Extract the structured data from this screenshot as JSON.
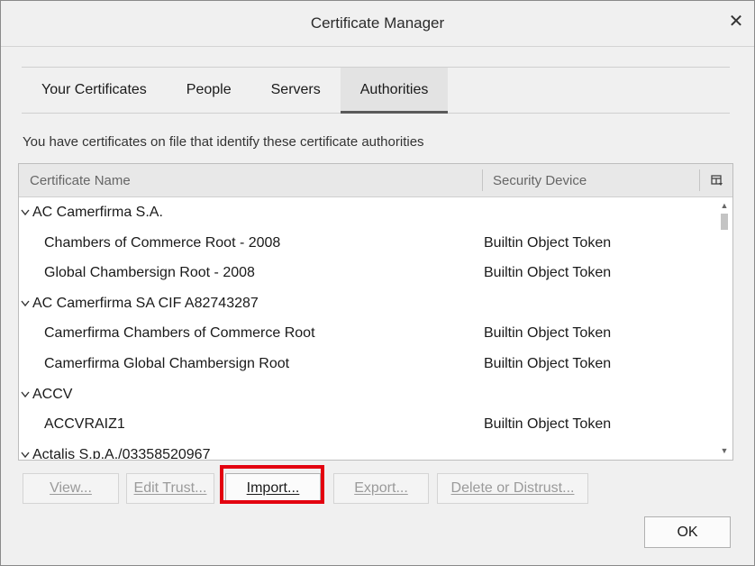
{
  "window": {
    "title": "Certificate Manager"
  },
  "tabs": [
    {
      "label": "Your Certificates",
      "active": false
    },
    {
      "label": "People",
      "active": false
    },
    {
      "label": "Servers",
      "active": false
    },
    {
      "label": "Authorities",
      "active": true
    }
  ],
  "description": "You have certificates on file that identify these certificate authorities",
  "tree": {
    "columns": {
      "name": "Certificate Name",
      "device": "Security Device"
    },
    "rows": [
      {
        "type": "group",
        "name": "AC Camerfirma S.A.",
        "device": ""
      },
      {
        "type": "child",
        "name": "Chambers of Commerce Root - 2008",
        "device": "Builtin Object Token"
      },
      {
        "type": "child",
        "name": "Global Chambersign Root - 2008",
        "device": "Builtin Object Token"
      },
      {
        "type": "group",
        "name": "AC Camerfirma SA CIF A82743287",
        "device": ""
      },
      {
        "type": "child",
        "name": "Camerfirma Chambers of Commerce Root",
        "device": "Builtin Object Token"
      },
      {
        "type": "child",
        "name": "Camerfirma Global Chambersign Root",
        "device": "Builtin Object Token"
      },
      {
        "type": "group",
        "name": "ACCV",
        "device": ""
      },
      {
        "type": "child",
        "name": "ACCVRAIZ1",
        "device": "Builtin Object Token"
      },
      {
        "type": "group",
        "name": "Actalis S.p.A./03358520967",
        "device": ""
      }
    ]
  },
  "buttons": {
    "view": "View...",
    "edit_trust": "Edit Trust...",
    "import": "Import...",
    "export": "Export...",
    "delete_distrust": "Delete or Distrust...",
    "ok": "OK"
  },
  "icons": {
    "close": "close-icon",
    "twisty": "chevron-down-icon",
    "column_picker": "column-picker-icon"
  },
  "colors": {
    "highlight": "#e3000f"
  }
}
